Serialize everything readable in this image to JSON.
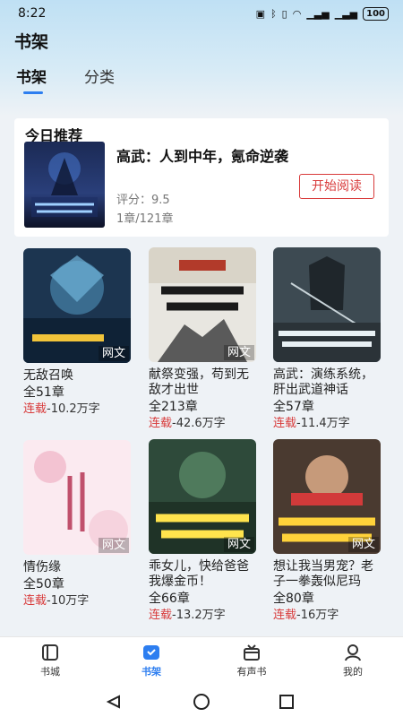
{
  "status_bar": {
    "time": "8:22",
    "battery": "100"
  },
  "app": {
    "title": "书架"
  },
  "tabs": [
    {
      "label": "书架",
      "active": true
    },
    {
      "label": "分类",
      "active": false
    }
  ],
  "recommend": {
    "header": "今日推荐",
    "title": "高武：人到中年，氪命逆袭",
    "score": "评分：9.5",
    "chapters": "1章/121章",
    "button": "开始阅读"
  },
  "books": [
    {
      "name": "无敌召唤",
      "count": "全51章",
      "serial": "连载",
      "words": "-10.2万字",
      "tag": "网文"
    },
    {
      "name": "献祭变强，苟到无敌才出世",
      "count": "全213章",
      "serial": "连载",
      "words": "-42.6万字",
      "tag": "网文"
    },
    {
      "name": "高武：演练系统，肝出武道神话",
      "count": "全57章",
      "serial": "连载",
      "words": "-11.4万字",
      "tag": "网文"
    },
    {
      "name": "情伤缘",
      "count": "全50章",
      "serial": "连载",
      "words": "-10万字",
      "tag": "网文"
    },
    {
      "name": "乖女儿，快给爸爸我爆金币！",
      "count": "全66章",
      "serial": "连载",
      "words": "-13.2万字",
      "tag": "网文"
    },
    {
      "name": "想让我当男宠？老子一拳轰似尼玛",
      "count": "全80章",
      "serial": "连载",
      "words": "-16万字",
      "tag": "网文"
    }
  ],
  "bottom_nav": [
    {
      "label": "书城",
      "icon": "bookstore-icon",
      "active": false
    },
    {
      "label": "书架",
      "icon": "bookshelf-icon",
      "active": true
    },
    {
      "label": "有声书",
      "icon": "audiobook-icon",
      "active": false
    },
    {
      "label": "我的",
      "icon": "profile-icon",
      "active": false
    }
  ],
  "colors": {
    "accent": "#2d7ef0",
    "serial": "#d83a3a",
    "button": "#d83a3a"
  }
}
